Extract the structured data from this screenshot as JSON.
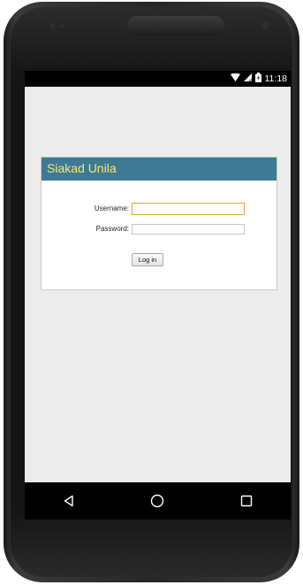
{
  "statusbar": {
    "time": "11:18",
    "icons": [
      "wifi-icon",
      "signal-icon",
      "battery-icon"
    ]
  },
  "login": {
    "title": "Siakad Unila",
    "username_label": "Username:",
    "password_label": "Password:",
    "username_value": "",
    "password_value": "",
    "submit_label": "Log in"
  },
  "navbar": {
    "icons": [
      "back-icon",
      "home-icon",
      "recents-icon"
    ]
  },
  "colors": {
    "header": "#3e7a93",
    "title_text": "#f6e96e",
    "focus_border": "#e0a53a",
    "page_background": "#ececec"
  }
}
